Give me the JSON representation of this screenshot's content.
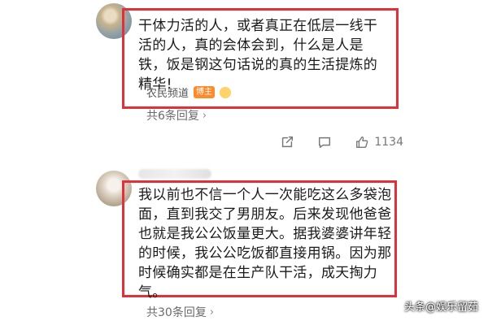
{
  "comments": [
    {
      "text": "干体力活的人，或者真正在低层一线干活的人，真的会体会到，什么是人是铁，饭是钢这句话说的真的生活提炼的精华!",
      "author": "农民频道",
      "author_badge": "博主",
      "replies_label": "共6条回复",
      "actions": {
        "like_count": "1134"
      }
    },
    {
      "text": "我以前也不信一个人一次能吃这么多袋泡面，直到我交了男朋友。后来发现他爸爸也就是我公公饭量更大。据我婆婆讲年轻的时候，我公公吃饭都直接用锅。因为那时候确实都是在生产队干活，成天掏力气。",
      "replies_label": "共30条回复"
    }
  ],
  "watermark": {
    "text": "头条@娱乐留茹"
  },
  "colors": {
    "highlight": "#e0303a",
    "badge": "#ff8a2a"
  }
}
